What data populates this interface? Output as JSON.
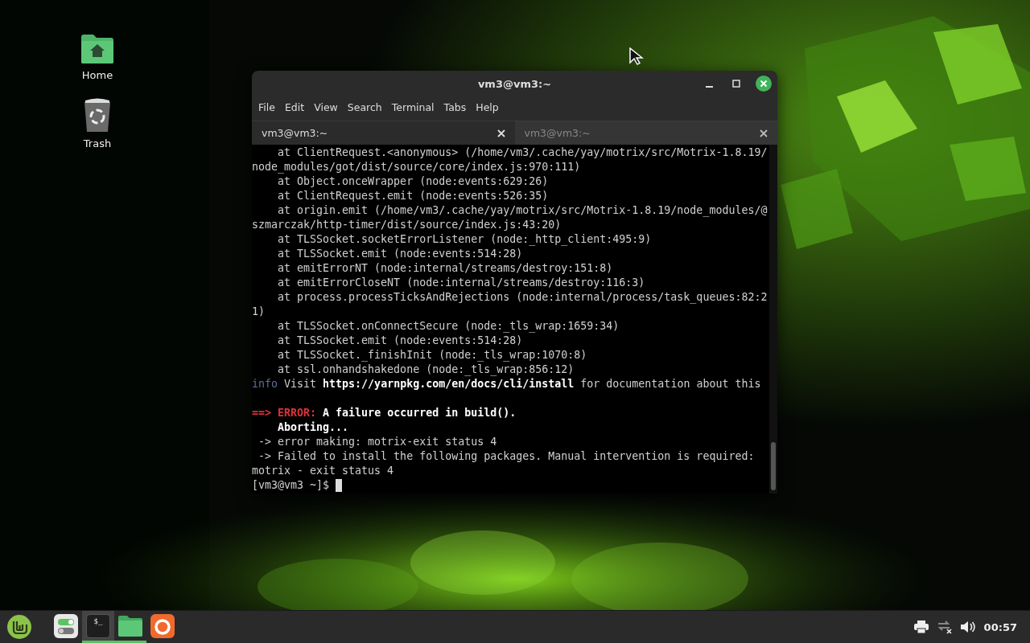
{
  "desktop_icons": [
    {
      "kind": "home",
      "label": "Home"
    },
    {
      "kind": "trash",
      "label": "Trash"
    }
  ],
  "window": {
    "title": "vm3@vm3:~",
    "menu": [
      "File",
      "Edit",
      "View",
      "Search",
      "Terminal",
      "Tabs",
      "Help"
    ],
    "tabs": [
      {
        "label": "vm3@vm3:~",
        "selected": true
      },
      {
        "label": "vm3@vm3:~",
        "selected": false
      }
    ],
    "lines": [
      {
        "kind": "text",
        "segments": [
          {
            "text": "    at ClientRequest.<anonymous> (/home/vm3/.cache/yay/motrix/src/Motrix-1.8.19/",
            "kind": "plain"
          }
        ]
      },
      {
        "kind": "text",
        "segments": [
          {
            "text": "node_modules/got/dist/source/core/index.js:970:111)",
            "kind": "plain"
          }
        ]
      },
      {
        "kind": "text",
        "segments": [
          {
            "text": "    at Object.onceWrapper (node:events:629:26)",
            "kind": "plain"
          }
        ]
      },
      {
        "kind": "text",
        "segments": [
          {
            "text": "    at ClientRequest.emit (node:events:526:35)",
            "kind": "plain"
          }
        ]
      },
      {
        "kind": "text",
        "segments": [
          {
            "text": "    at origin.emit (/home/vm3/.cache/yay/motrix/src/Motrix-1.8.19/node_modules/@",
            "kind": "plain"
          }
        ]
      },
      {
        "kind": "text",
        "segments": [
          {
            "text": "szmarczak/http-timer/dist/source/index.js:43:20)",
            "kind": "plain"
          }
        ]
      },
      {
        "kind": "text",
        "segments": [
          {
            "text": "    at TLSSocket.socketErrorListener (node:_http_client:495:9)",
            "kind": "plain"
          }
        ]
      },
      {
        "kind": "text",
        "segments": [
          {
            "text": "    at TLSSocket.emit (node:events:514:28)",
            "kind": "plain"
          }
        ]
      },
      {
        "kind": "text",
        "segments": [
          {
            "text": "    at emitErrorNT (node:internal/streams/destroy:151:8)",
            "kind": "plain"
          }
        ]
      },
      {
        "kind": "text",
        "segments": [
          {
            "text": "    at emitErrorCloseNT (node:internal/streams/destroy:116:3)",
            "kind": "plain"
          }
        ]
      },
      {
        "kind": "text",
        "segments": [
          {
            "text": "    at process.processTicksAndRejections (node:internal/process/task_queues:82:2",
            "kind": "plain"
          }
        ]
      },
      {
        "kind": "text",
        "segments": [
          {
            "text": "1)",
            "kind": "plain"
          }
        ]
      },
      {
        "kind": "text",
        "segments": [
          {
            "text": "    at TLSSocket.onConnectSecure (node:_tls_wrap:1659:34)",
            "kind": "plain"
          }
        ]
      },
      {
        "kind": "text",
        "segments": [
          {
            "text": "    at TLSSocket.emit (node:events:514:28)",
            "kind": "plain"
          }
        ]
      },
      {
        "kind": "text",
        "segments": [
          {
            "text": "    at TLSSocket._finishInit (node:_tls_wrap:1070:8)",
            "kind": "plain"
          }
        ]
      },
      {
        "kind": "text",
        "segments": [
          {
            "text": "    at ssl.onhandshakedone (node:_tls_wrap:856:12)",
            "kind": "plain"
          }
        ]
      },
      {
        "kind": "text",
        "segments": [
          {
            "text": "info",
            "kind": "info"
          },
          {
            "text": " Visit ",
            "kind": "plain"
          },
          {
            "text": "https://yarnpkg.com/en/docs/cli/install",
            "kind": "bold"
          },
          {
            "text": " for documentation about this",
            "kind": "plain"
          }
        ]
      },
      {
        "kind": "blank"
      },
      {
        "kind": "text",
        "segments": [
          {
            "text": "==>",
            "kind": "error"
          },
          {
            "text": " ERROR:",
            "kind": "error"
          },
          {
            "text": " A failure occurred in build().",
            "kind": "bold"
          }
        ]
      },
      {
        "kind": "text",
        "segments": [
          {
            "text": "    Aborting...",
            "kind": "bold"
          }
        ]
      },
      {
        "kind": "text",
        "segments": [
          {
            "text": " -> error making: motrix-exit status 4",
            "kind": "plain"
          }
        ]
      },
      {
        "kind": "text",
        "segments": [
          {
            "text": " -> Failed to install the following packages. Manual intervention is required:",
            "kind": "plain"
          }
        ]
      },
      {
        "kind": "text",
        "segments": [
          {
            "text": "motrix - exit status 4",
            "kind": "plain"
          }
        ]
      },
      {
        "kind": "prompt",
        "segments": [
          {
            "text": "[vm3@vm3 ~]$ ",
            "kind": "plain"
          }
        ]
      }
    ]
  },
  "taskbar": {
    "apps": [
      {
        "kind": "settings",
        "selected": false,
        "running": false
      },
      {
        "kind": "terminal",
        "label": "$_",
        "selected": true,
        "running": true
      },
      {
        "kind": "files",
        "selected": false,
        "running": true
      },
      {
        "kind": "browser",
        "selected": false,
        "running": false
      }
    ],
    "tray": [
      {
        "kind": "printer"
      },
      {
        "kind": "network"
      },
      {
        "kind": "volume"
      }
    ],
    "clock": "00:57"
  }
}
